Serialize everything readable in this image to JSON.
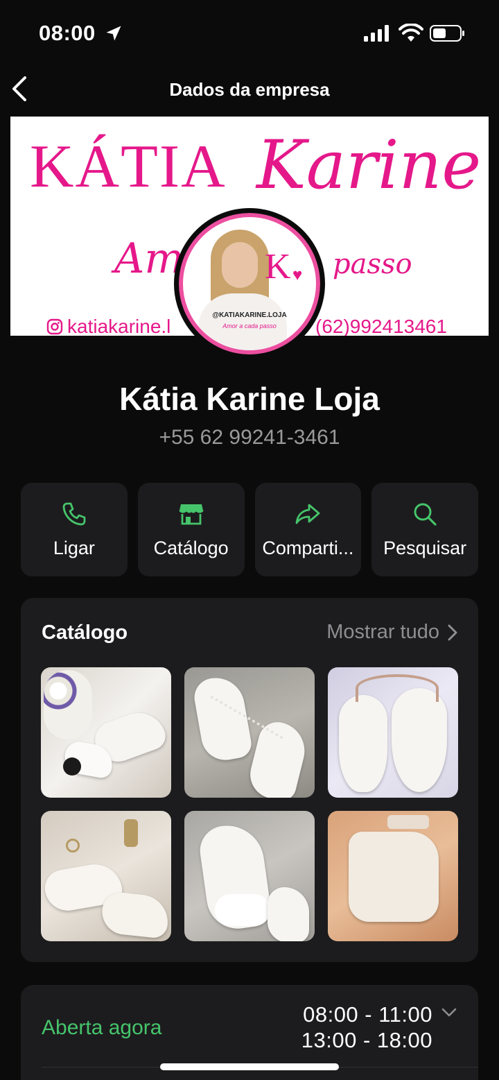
{
  "status_bar": {
    "time": "08:00"
  },
  "nav": {
    "title": "Dados da empresa"
  },
  "banner": {
    "brand": "KÁTIA",
    "brand_script": "Karine",
    "tagline_left": "Amo",
    "tagline_right": "passo",
    "instagram": "katiakarine.l",
    "phone": "(62)992413461"
  },
  "avatar": {
    "handle": "@KATIAKARINE.LOJA",
    "tagline": "Amor a cada passo",
    "letter": "K"
  },
  "profile": {
    "name": "Kátia Karine Loja",
    "phone": "+55 62 99241-3461"
  },
  "actions": [
    {
      "label": "Ligar",
      "icon": "phone-icon"
    },
    {
      "label": "Catálogo",
      "icon": "storefront-icon"
    },
    {
      "label": "Comparti...",
      "icon": "share-arrow-icon"
    },
    {
      "label": "Pesquisar",
      "icon": "search-icon"
    }
  ],
  "catalog": {
    "title": "Catálogo",
    "show_all": "Mostrar tudo",
    "items": [
      "bridal-bow-heels",
      "pearl-strap-sandals",
      "pearl-pointed-heels",
      "floral-ankle-strap-heels",
      "bow-strap-sandals",
      "platform-block-heels"
    ]
  },
  "hours": {
    "status": "Aberta agora",
    "ranges": [
      "08:00 - 11:00",
      "13:00 - 18:00"
    ]
  },
  "colors": {
    "accent_green": "#46c46b",
    "brand_pink": "#e5188a",
    "card_bg": "#1c1c1e"
  }
}
